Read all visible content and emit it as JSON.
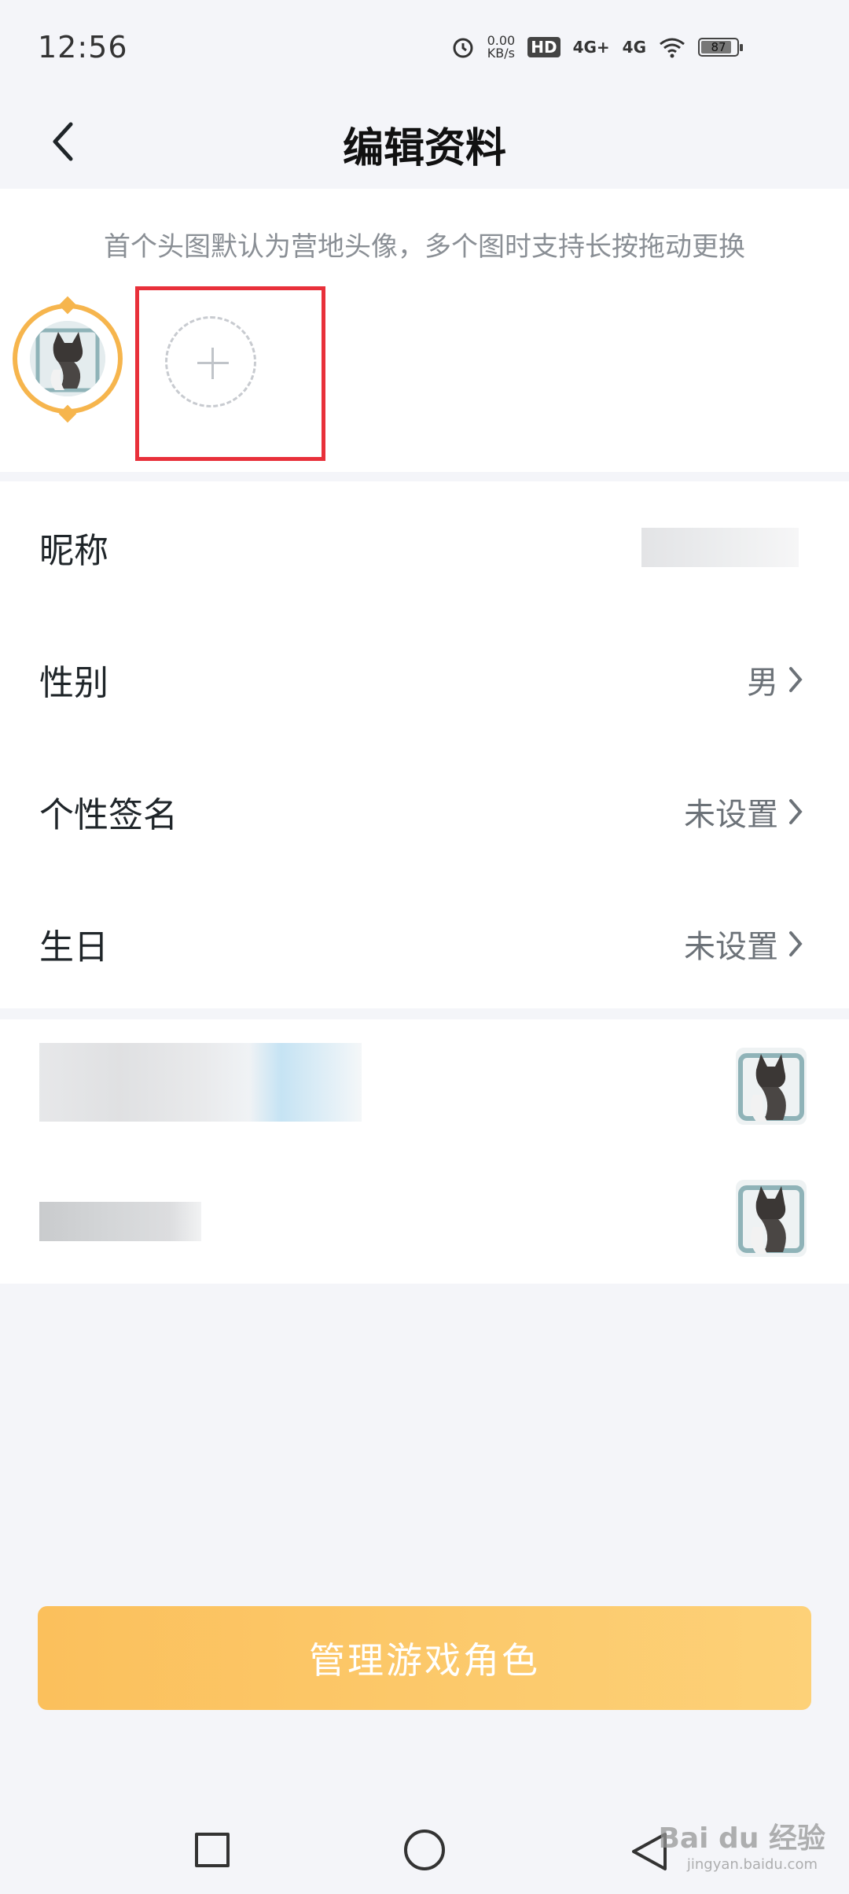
{
  "status_bar": {
    "time": "12:56",
    "speed_value": "0.00",
    "speed_unit": "KB/s",
    "hd_badge": "HD",
    "network_1": "4G+",
    "network_2": "4G",
    "battery_level": "87"
  },
  "header": {
    "title": "编辑资料"
  },
  "avatar_section": {
    "hint": "首个头图默认为营地头像，多个图时支持长按拖动更换"
  },
  "profile": {
    "nickname_label": "昵称",
    "gender_label": "性别",
    "gender_value": "男",
    "signature_label": "个性签名",
    "signature_value": "未设置",
    "birthday_label": "生日",
    "birthday_value": "未设置"
  },
  "manage_button": {
    "label": "管理游戏角色"
  },
  "watermark": {
    "brand": "Bai du 经验",
    "url": "jingyan.baidu.com"
  },
  "colors": {
    "accent_orange": "#f6b54d",
    "button_gradient_start": "#fbc05c",
    "button_gradient_end": "#fdd178",
    "highlight_red": "#e8303a"
  }
}
